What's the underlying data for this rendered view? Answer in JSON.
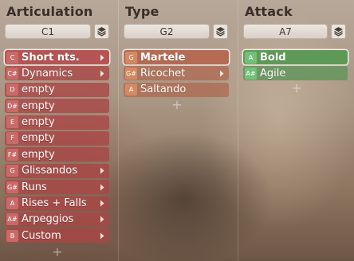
{
  "columns": [
    {
      "title": "Articulation",
      "key": "C1",
      "items": [
        {
          "note": "C",
          "label": "Short nts.",
          "selected": true,
          "has_submenu": true
        },
        {
          "note": "C#",
          "label": "Dynamics",
          "has_submenu": true
        },
        {
          "note": "D",
          "label": "empty"
        },
        {
          "note": "D#",
          "label": "empty"
        },
        {
          "note": "E",
          "label": "empty"
        },
        {
          "note": "F",
          "label": "empty"
        },
        {
          "note": "F#",
          "label": "empty"
        },
        {
          "note": "G",
          "label": "Glissandos",
          "has_submenu": true
        },
        {
          "note": "G#",
          "label": "Runs",
          "has_submenu": true
        },
        {
          "note": "A",
          "label": "Rises + Falls",
          "has_submenu": true
        },
        {
          "note": "A#",
          "label": "Arpeggios",
          "has_submenu": true
        },
        {
          "note": "B",
          "label": "Custom",
          "has_submenu": true
        }
      ]
    },
    {
      "title": "Type",
      "key": "G2",
      "items": [
        {
          "note": "G",
          "label": "Martele",
          "selected": true
        },
        {
          "note": "G#",
          "label": "Ricochet",
          "has_submenu": true
        },
        {
          "note": "A",
          "label": "Saltando"
        }
      ]
    },
    {
      "title": "Attack",
      "key": "A7",
      "items": [
        {
          "note": "A",
          "label": "Bold",
          "selected": true
        },
        {
          "note": "A#",
          "label": "Agile"
        }
      ]
    }
  ],
  "add_symbol": "+",
  "icons": {
    "layers": "layers-icon",
    "chevron": "chevron-right-icon",
    "add": "plus-icon"
  },
  "colors": {
    "articulation": "#aa4646",
    "type": "#af6c55",
    "attack": "#68965e"
  }
}
